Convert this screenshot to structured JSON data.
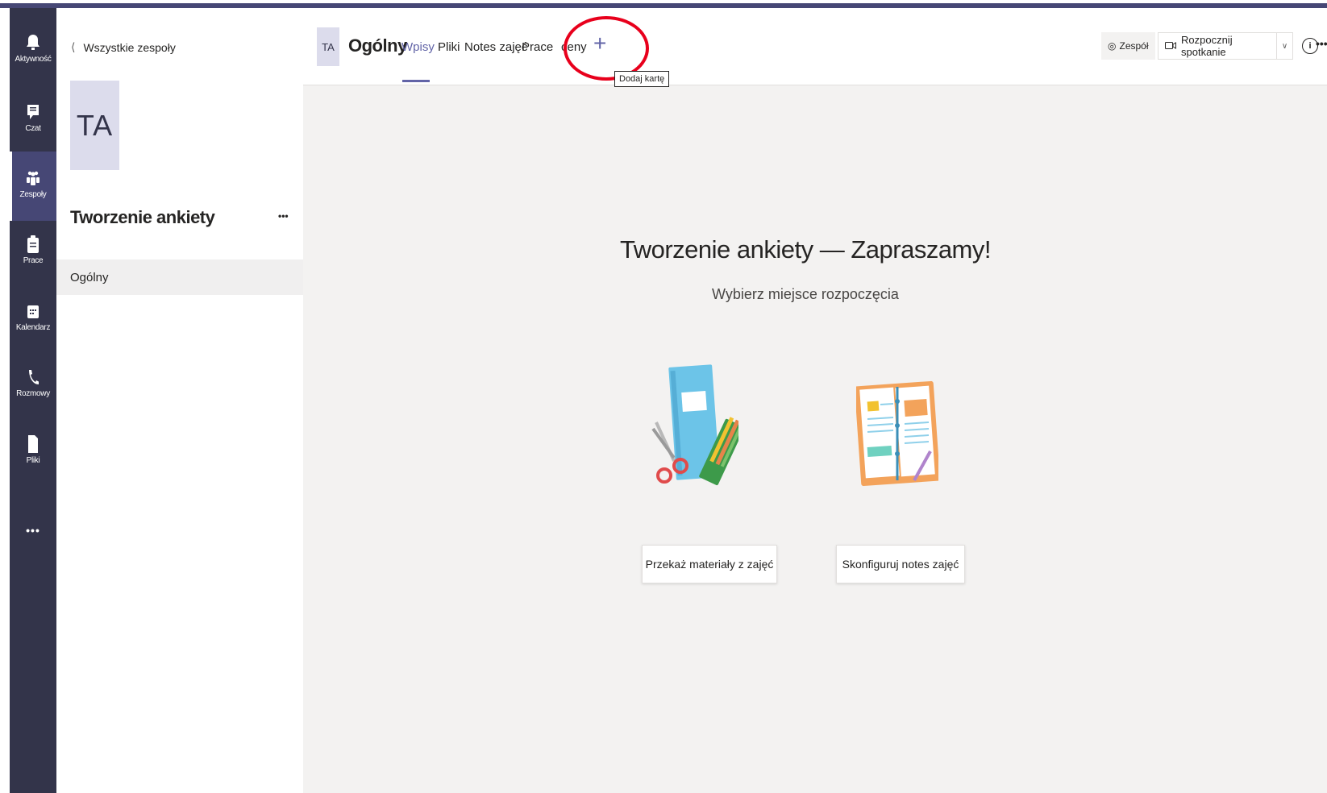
{
  "rail": {
    "items": [
      {
        "label": "Aktywność",
        "icon": "bell-icon"
      },
      {
        "label": "Czat",
        "icon": "chat-icon"
      },
      {
        "label": "Zespoły",
        "icon": "teams-icon"
      },
      {
        "label": "Prace",
        "icon": "assignments-icon"
      },
      {
        "label": "Kalendarz",
        "icon": "calendar-icon"
      },
      {
        "label": "Rozmowy",
        "icon": "phone-icon"
      },
      {
        "label": "Pliki",
        "icon": "file-icon"
      }
    ],
    "more": "•••"
  },
  "team_panel": {
    "back_label": "Wszystkie zespoły",
    "avatar_initials": "TA",
    "team_name": "Tworzenie ankiety",
    "more": "•••",
    "channels": [
      {
        "label": "Ogólny"
      }
    ]
  },
  "header": {
    "avatar_initials": "TA",
    "channel_title": "Ogólny",
    "tabs": [
      {
        "label": "Wpisy"
      },
      {
        "label": "Pliki"
      },
      {
        "label": "Notes zajęć"
      },
      {
        "label": "Prace"
      },
      {
        "label": "ceny"
      }
    ],
    "add_tab": "+",
    "add_tab_tooltip": "Dodaj kartę",
    "team_button": "Zespół",
    "meet_button": "Rozpocznij spotkanie",
    "info": "i",
    "more": "•••"
  },
  "welcome": {
    "title": "Tworzenie ankiety — Zapraszamy!",
    "subtitle": "Wybierz miejsce rozpoczęcia",
    "buttons": [
      {
        "label": "Przekaż materiały z zajęć"
      },
      {
        "label": "Skonfiguruj notes zajęć"
      }
    ]
  },
  "colors": {
    "accent": "#6264a7",
    "rail_bg": "#33344a",
    "annotation": "#e8001c"
  }
}
